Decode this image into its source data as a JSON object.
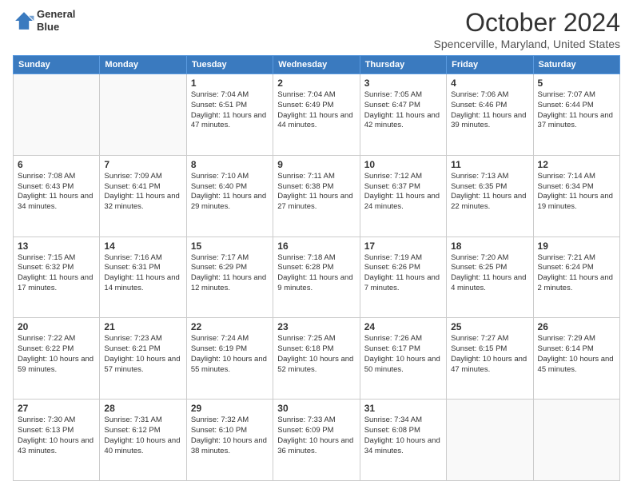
{
  "header": {
    "logo_line1": "General",
    "logo_line2": "Blue",
    "month": "October 2024",
    "location": "Spencerville, Maryland, United States"
  },
  "days_of_week": [
    "Sunday",
    "Monday",
    "Tuesday",
    "Wednesday",
    "Thursday",
    "Friday",
    "Saturday"
  ],
  "weeks": [
    [
      {
        "day": "",
        "info": ""
      },
      {
        "day": "",
        "info": ""
      },
      {
        "day": "1",
        "info": "Sunrise: 7:04 AM\nSunset: 6:51 PM\nDaylight: 11 hours and 47 minutes."
      },
      {
        "day": "2",
        "info": "Sunrise: 7:04 AM\nSunset: 6:49 PM\nDaylight: 11 hours and 44 minutes."
      },
      {
        "day": "3",
        "info": "Sunrise: 7:05 AM\nSunset: 6:47 PM\nDaylight: 11 hours and 42 minutes."
      },
      {
        "day": "4",
        "info": "Sunrise: 7:06 AM\nSunset: 6:46 PM\nDaylight: 11 hours and 39 minutes."
      },
      {
        "day": "5",
        "info": "Sunrise: 7:07 AM\nSunset: 6:44 PM\nDaylight: 11 hours and 37 minutes."
      }
    ],
    [
      {
        "day": "6",
        "info": "Sunrise: 7:08 AM\nSunset: 6:43 PM\nDaylight: 11 hours and 34 minutes."
      },
      {
        "day": "7",
        "info": "Sunrise: 7:09 AM\nSunset: 6:41 PM\nDaylight: 11 hours and 32 minutes."
      },
      {
        "day": "8",
        "info": "Sunrise: 7:10 AM\nSunset: 6:40 PM\nDaylight: 11 hours and 29 minutes."
      },
      {
        "day": "9",
        "info": "Sunrise: 7:11 AM\nSunset: 6:38 PM\nDaylight: 11 hours and 27 minutes."
      },
      {
        "day": "10",
        "info": "Sunrise: 7:12 AM\nSunset: 6:37 PM\nDaylight: 11 hours and 24 minutes."
      },
      {
        "day": "11",
        "info": "Sunrise: 7:13 AM\nSunset: 6:35 PM\nDaylight: 11 hours and 22 minutes."
      },
      {
        "day": "12",
        "info": "Sunrise: 7:14 AM\nSunset: 6:34 PM\nDaylight: 11 hours and 19 minutes."
      }
    ],
    [
      {
        "day": "13",
        "info": "Sunrise: 7:15 AM\nSunset: 6:32 PM\nDaylight: 11 hours and 17 minutes."
      },
      {
        "day": "14",
        "info": "Sunrise: 7:16 AM\nSunset: 6:31 PM\nDaylight: 11 hours and 14 minutes."
      },
      {
        "day": "15",
        "info": "Sunrise: 7:17 AM\nSunset: 6:29 PM\nDaylight: 11 hours and 12 minutes."
      },
      {
        "day": "16",
        "info": "Sunrise: 7:18 AM\nSunset: 6:28 PM\nDaylight: 11 hours and 9 minutes."
      },
      {
        "day": "17",
        "info": "Sunrise: 7:19 AM\nSunset: 6:26 PM\nDaylight: 11 hours and 7 minutes."
      },
      {
        "day": "18",
        "info": "Sunrise: 7:20 AM\nSunset: 6:25 PM\nDaylight: 11 hours and 4 minutes."
      },
      {
        "day": "19",
        "info": "Sunrise: 7:21 AM\nSunset: 6:24 PM\nDaylight: 11 hours and 2 minutes."
      }
    ],
    [
      {
        "day": "20",
        "info": "Sunrise: 7:22 AM\nSunset: 6:22 PM\nDaylight: 10 hours and 59 minutes."
      },
      {
        "day": "21",
        "info": "Sunrise: 7:23 AM\nSunset: 6:21 PM\nDaylight: 10 hours and 57 minutes."
      },
      {
        "day": "22",
        "info": "Sunrise: 7:24 AM\nSunset: 6:19 PM\nDaylight: 10 hours and 55 minutes."
      },
      {
        "day": "23",
        "info": "Sunrise: 7:25 AM\nSunset: 6:18 PM\nDaylight: 10 hours and 52 minutes."
      },
      {
        "day": "24",
        "info": "Sunrise: 7:26 AM\nSunset: 6:17 PM\nDaylight: 10 hours and 50 minutes."
      },
      {
        "day": "25",
        "info": "Sunrise: 7:27 AM\nSunset: 6:15 PM\nDaylight: 10 hours and 47 minutes."
      },
      {
        "day": "26",
        "info": "Sunrise: 7:29 AM\nSunset: 6:14 PM\nDaylight: 10 hours and 45 minutes."
      }
    ],
    [
      {
        "day": "27",
        "info": "Sunrise: 7:30 AM\nSunset: 6:13 PM\nDaylight: 10 hours and 43 minutes."
      },
      {
        "day": "28",
        "info": "Sunrise: 7:31 AM\nSunset: 6:12 PM\nDaylight: 10 hours and 40 minutes."
      },
      {
        "day": "29",
        "info": "Sunrise: 7:32 AM\nSunset: 6:10 PM\nDaylight: 10 hours and 38 minutes."
      },
      {
        "day": "30",
        "info": "Sunrise: 7:33 AM\nSunset: 6:09 PM\nDaylight: 10 hours and 36 minutes."
      },
      {
        "day": "31",
        "info": "Sunrise: 7:34 AM\nSunset: 6:08 PM\nDaylight: 10 hours and 34 minutes."
      },
      {
        "day": "",
        "info": ""
      },
      {
        "day": "",
        "info": ""
      }
    ]
  ]
}
